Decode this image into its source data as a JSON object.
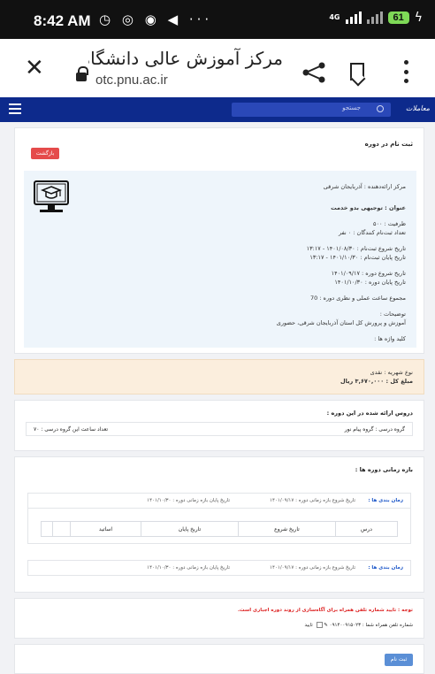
{
  "status": {
    "time": "8:42 AM",
    "left_icons": "◷ ◎ ◉ ◀ ···",
    "network": "4G",
    "battery": "61"
  },
  "browser": {
    "page_title": "مرکز آموزش عالی دانشگاه پ..",
    "url": "otc.pnu.ac.ir"
  },
  "nav": {
    "search_placeholder": "جستجو",
    "logo_text": "معاملات"
  },
  "course": {
    "page_heading": "ثبت نام در دوره",
    "return_button": "بازگشت",
    "provider": "مرکز ارائه‌دهنده : آذربایجان شرقی",
    "title": "عنوان : توجیهی بدو خدمت",
    "capacity": "ظرفیت : ۵۰۰",
    "registrants": "تعداد ثبت‌نام کنندگان : ۰ نفر",
    "reg_start": "تاریخ شروع ثبت‌نام : ۱۴۰۱/۰۸/۳۰ - ۱۳:۱۷",
    "reg_end": "تاریخ پایان ثبت‌نام : ۱۴۰۱/۱۰/۳۰ - ۱۳:۱۷",
    "course_start": "تاریخ شروع دوره : ۱۴۰۱/۰۹/۱۷",
    "course_end": "تاریخ پایان دوره : ۱۴۰۱/۱۰/۳۰",
    "total_hours": "مجموع ساعت عملی و نظری دوره : 70",
    "description_label": "توضیحات :",
    "description": "آموزش و پرورش کل استان آذربایجان شرقی، حضوری",
    "keywords": "کلید واژه ها :"
  },
  "payment": {
    "type": "نوع شهریه : نقدی",
    "amount": "مبلغ کل : ۳,۶۷۰,۰۰۰ ریال"
  },
  "lessons": {
    "heading": "دروس ارائه شده در این دوره :",
    "group": "گروه درسی : گروه پیام نور",
    "group_hours": "تعداد ساعت این گروه درسی : ۷۰"
  },
  "periods": {
    "heading": "بازه زمانی دوره ها :",
    "row_label": "زمان بندی ها :",
    "start": "تاریخ شروع بازه زمانی دوره : ۱۴۰۱/۰۹/۱۷",
    "end": "تاریخ پایان بازه زمانی دوره : ۱۴۰۱/۱۰/۳۰",
    "table_headers": [
      "درس",
      "تاریخ شروع",
      "تاریخ پایان",
      "اساتید",
      ""
    ]
  },
  "note": {
    "title": "توجه : تایید شماره تلفن همراه برای آگاه‌سازی از روند دوره اجباری است.",
    "phone_label": "شماره تلفن همراه شما : ۰۹۱۴۰۰۹۱۵۰۲۳",
    "confirm_label": "تایید"
  },
  "submit": {
    "label": "ثبت نام"
  }
}
